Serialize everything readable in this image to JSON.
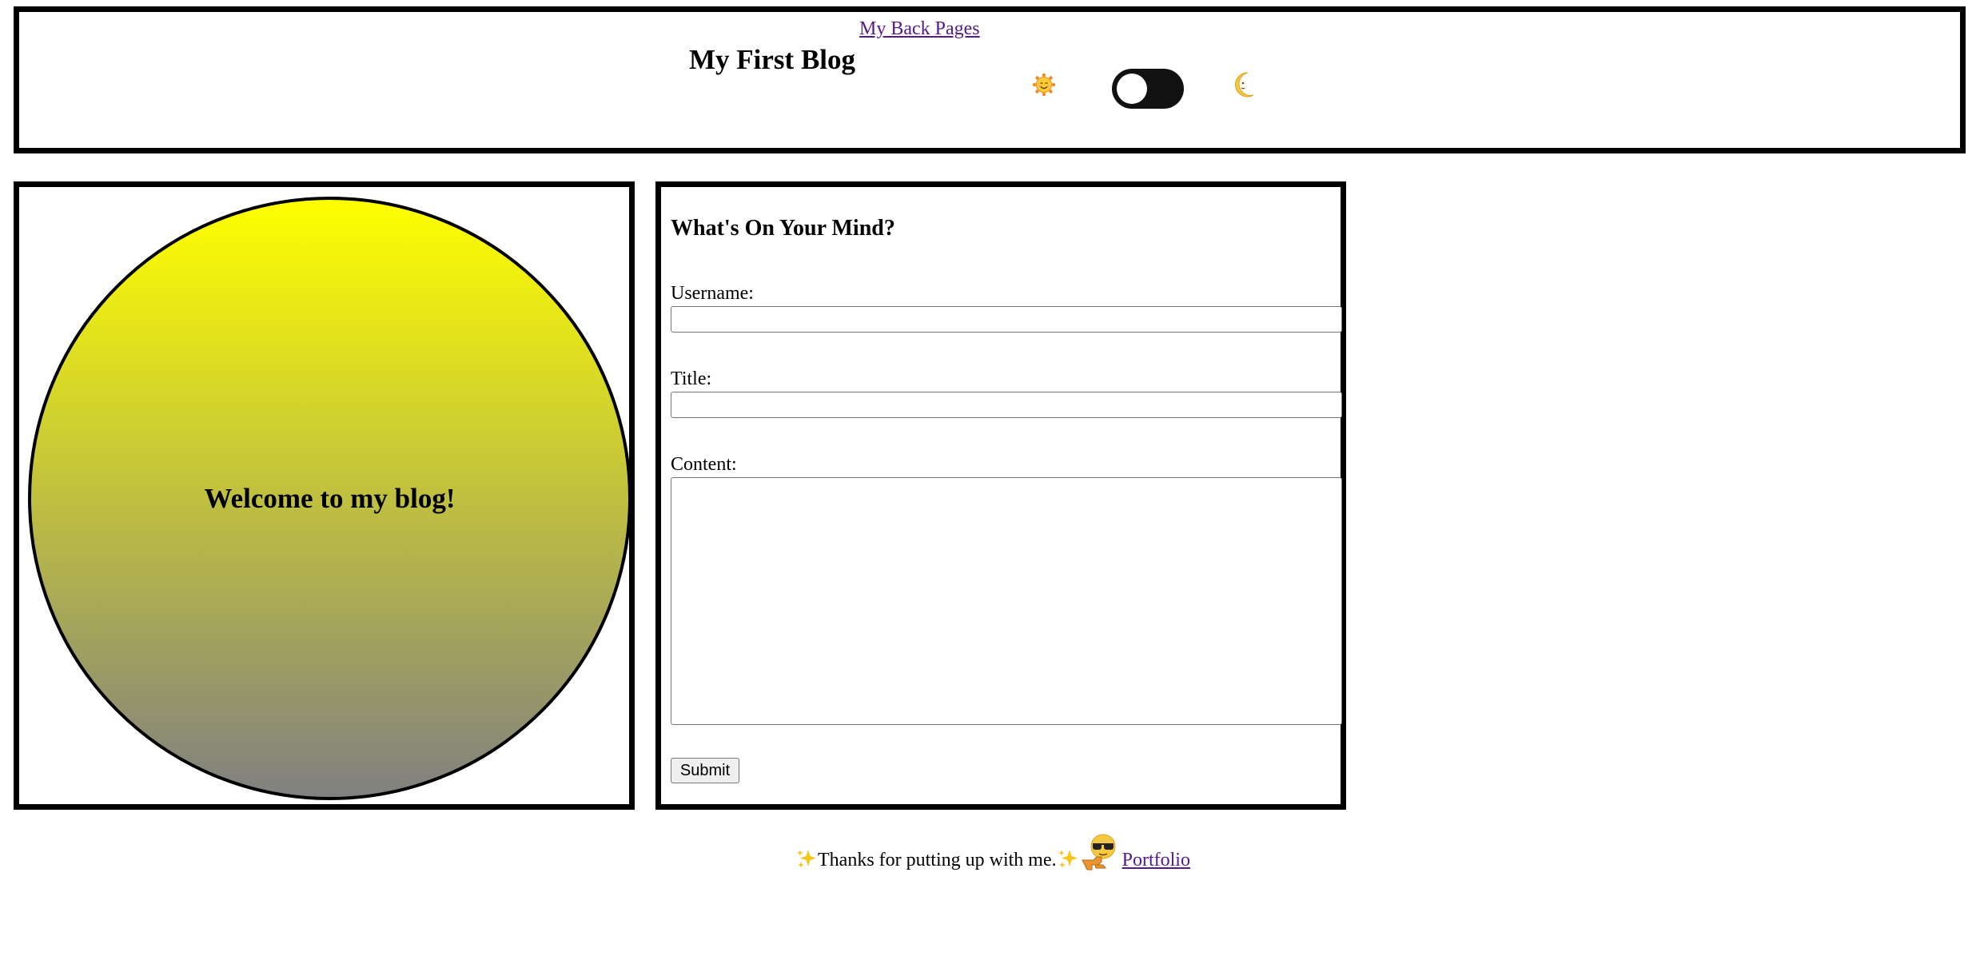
{
  "header": {
    "back_link": "My Back Pages",
    "title": "My First Blog",
    "theme_toggle": {
      "state": "light",
      "left_icon": "sun-smile-icon",
      "right_icon": "crescent-moon-icon"
    }
  },
  "hero": {
    "welcome": "Welcome to my blog!",
    "gradient_colors": [
      "#ffff00",
      "#808080"
    ]
  },
  "form": {
    "heading": "What's On Your Mind?",
    "username_label": "Username:",
    "username_value": "",
    "title_label": "Title:",
    "title_value": "",
    "content_label": "Content:",
    "content_value": "",
    "submit_label": "Submit"
  },
  "footer": {
    "thanks_text": "Thanks for putting up with me.",
    "sparkle_icon": "sparkles-icon",
    "cool_icon": "sunglasses-pointing-icon",
    "portfolio_link": "Portfolio"
  },
  "colors": {
    "link": "#551a8b",
    "border": "#000000",
    "toggle": "#111111"
  }
}
